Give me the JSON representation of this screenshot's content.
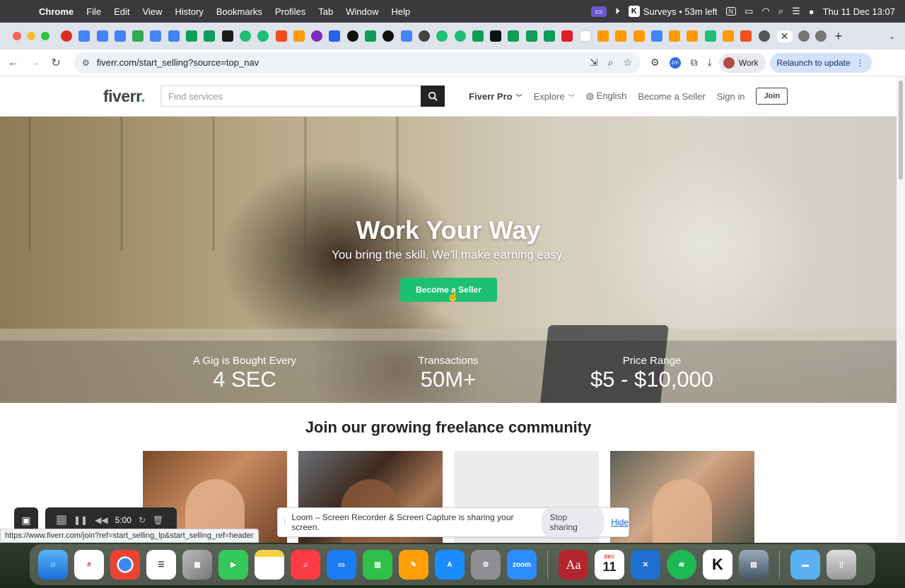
{
  "menubar": {
    "app_name": "Chrome",
    "items": [
      "File",
      "Edit",
      "View",
      "History",
      "Bookmarks",
      "Profiles",
      "Tab",
      "Window",
      "Help"
    ],
    "surveys": "Surveys • 53m left",
    "datetime": "Thu 11 Dec  13:07"
  },
  "browser": {
    "url": "fiverr.com/start_selling?source=top_nav",
    "profile_label": "Work",
    "relaunch_label": "Relaunch to update"
  },
  "header": {
    "logo": "fiverr",
    "logo_dot": ".",
    "search_placeholder": "Find services",
    "nav": {
      "fiverr_pro": "Fiverr Pro",
      "explore": "Explore",
      "language": "English",
      "become_seller": "Become a Seller",
      "sign_in": "Sign in",
      "join": "Join"
    }
  },
  "hero": {
    "title": "Work Your Way",
    "subtitle": "You bring the skill. We'll make earning easy.",
    "cta": "Become a Seller",
    "stats": [
      {
        "label": "A Gig is Bought Every",
        "value": "4 SEC"
      },
      {
        "label": "Transactions",
        "value": "50M+"
      },
      {
        "label": "Price Range",
        "value": "$5 - $10,000"
      }
    ]
  },
  "community": {
    "heading": "Join our growing freelance community"
  },
  "status_url": "https://www.fiverr.com/join?ref=start_selling_lp&start_selling_ref=header",
  "loom": {
    "timer": "5:00",
    "share_message": "Loom – Screen Recorder & Screen Capture is sharing your screen.",
    "stop_label": "Stop sharing",
    "hide_label": "Hide"
  },
  "dock": {
    "calendar_month": "DEC",
    "calendar_day": "11",
    "zoom_label": "zoom",
    "dictionary_label": "Aa"
  },
  "colors": {
    "fiverr_green": "#1dbf73",
    "text_dark": "#404145"
  }
}
